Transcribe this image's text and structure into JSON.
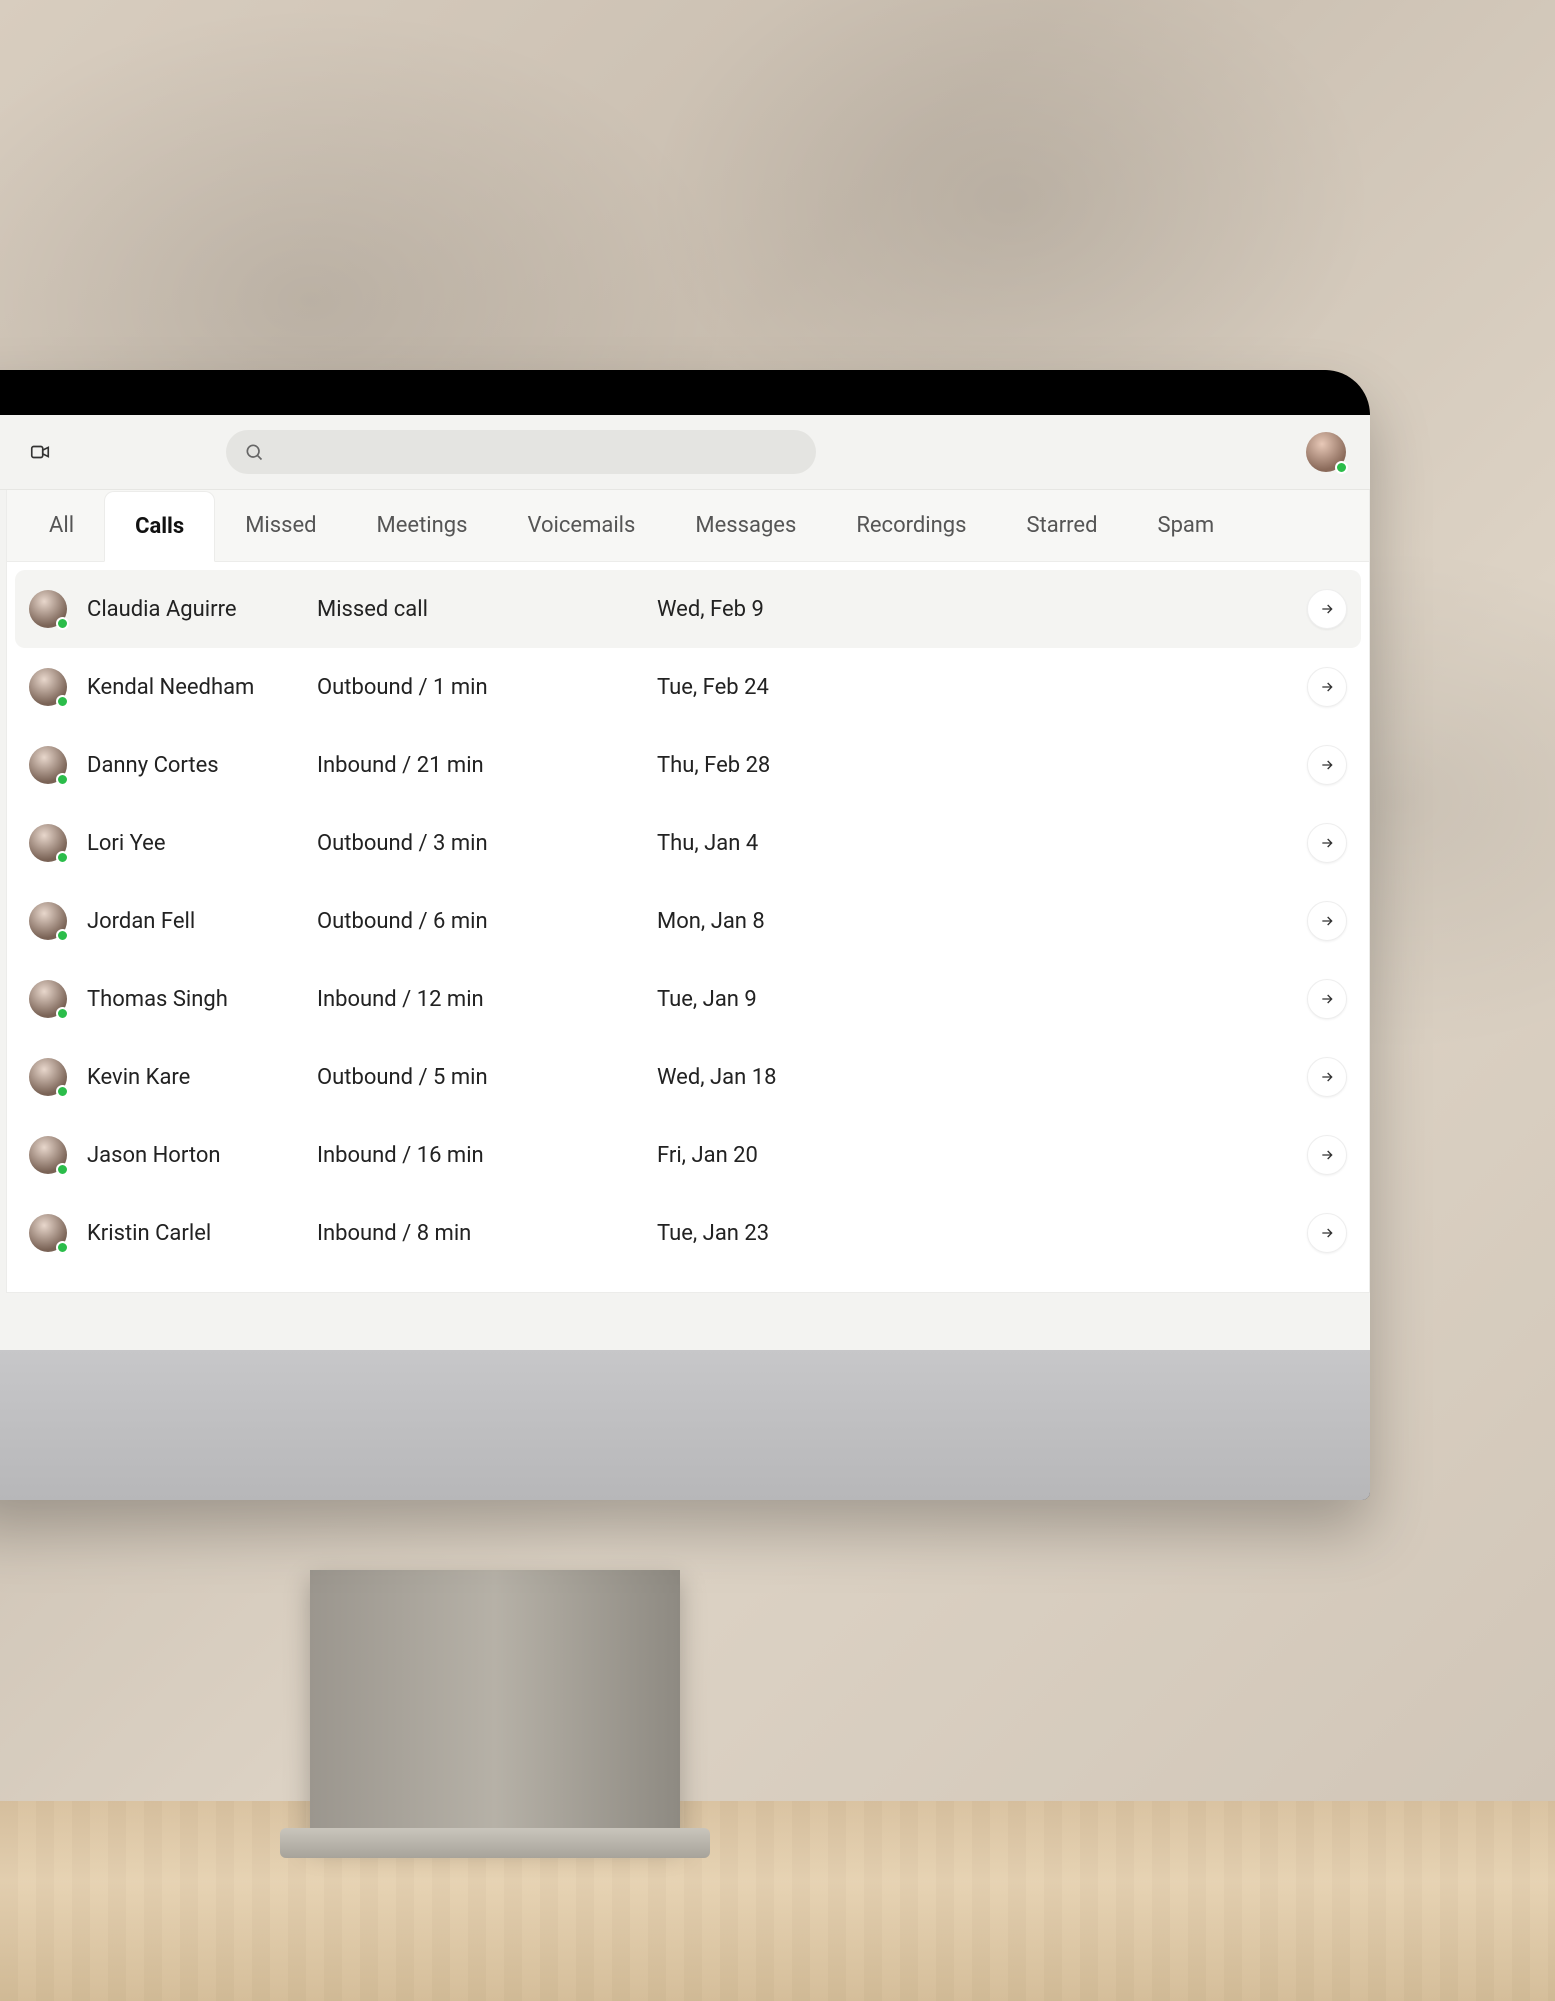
{
  "topbar": {
    "search_placeholder": ""
  },
  "tabs": [
    {
      "label": "All",
      "active": false
    },
    {
      "label": "Calls",
      "active": true
    },
    {
      "label": "Missed",
      "active": false
    },
    {
      "label": "Meetings",
      "active": false
    },
    {
      "label": "Voicemails",
      "active": false
    },
    {
      "label": "Messages",
      "active": false
    },
    {
      "label": "Recordings",
      "active": false
    },
    {
      "label": "Starred",
      "active": false
    },
    {
      "label": "Spam",
      "active": false
    }
  ],
  "calls": [
    {
      "name": "Claudia Aguirre",
      "status": "Missed call",
      "date": "Wed, Feb 9",
      "highlight": true
    },
    {
      "name": "Kendal Needham",
      "status": "Outbound / 1 min",
      "date": "Tue, Feb 24",
      "highlight": false
    },
    {
      "name": "Danny Cortes",
      "status": "Inbound / 21 min",
      "date": "Thu, Feb 28",
      "highlight": false
    },
    {
      "name": "Lori Yee",
      "status": "Outbound / 3 min",
      "date": "Thu, Jan 4",
      "highlight": false
    },
    {
      "name": "Jordan Fell",
      "status": "Outbound / 6 min",
      "date": "Mon, Jan 8",
      "highlight": false
    },
    {
      "name": "Thomas Singh",
      "status": "Inbound / 12 min",
      "date": "Tue, Jan 9",
      "highlight": false
    },
    {
      "name": "Kevin Kare",
      "status": "Outbound / 5 min",
      "date": "Wed, Jan 18",
      "highlight": false
    },
    {
      "name": "Jason Horton",
      "status": "Inbound / 16 min",
      "date": "Fri, Jan 20",
      "highlight": false
    },
    {
      "name": "Kristin Carlel",
      "status": "Inbound / 8 min",
      "date": "Tue, Jan 23",
      "highlight": false
    }
  ],
  "colors": {
    "presence_online": "#2bbd4a"
  }
}
